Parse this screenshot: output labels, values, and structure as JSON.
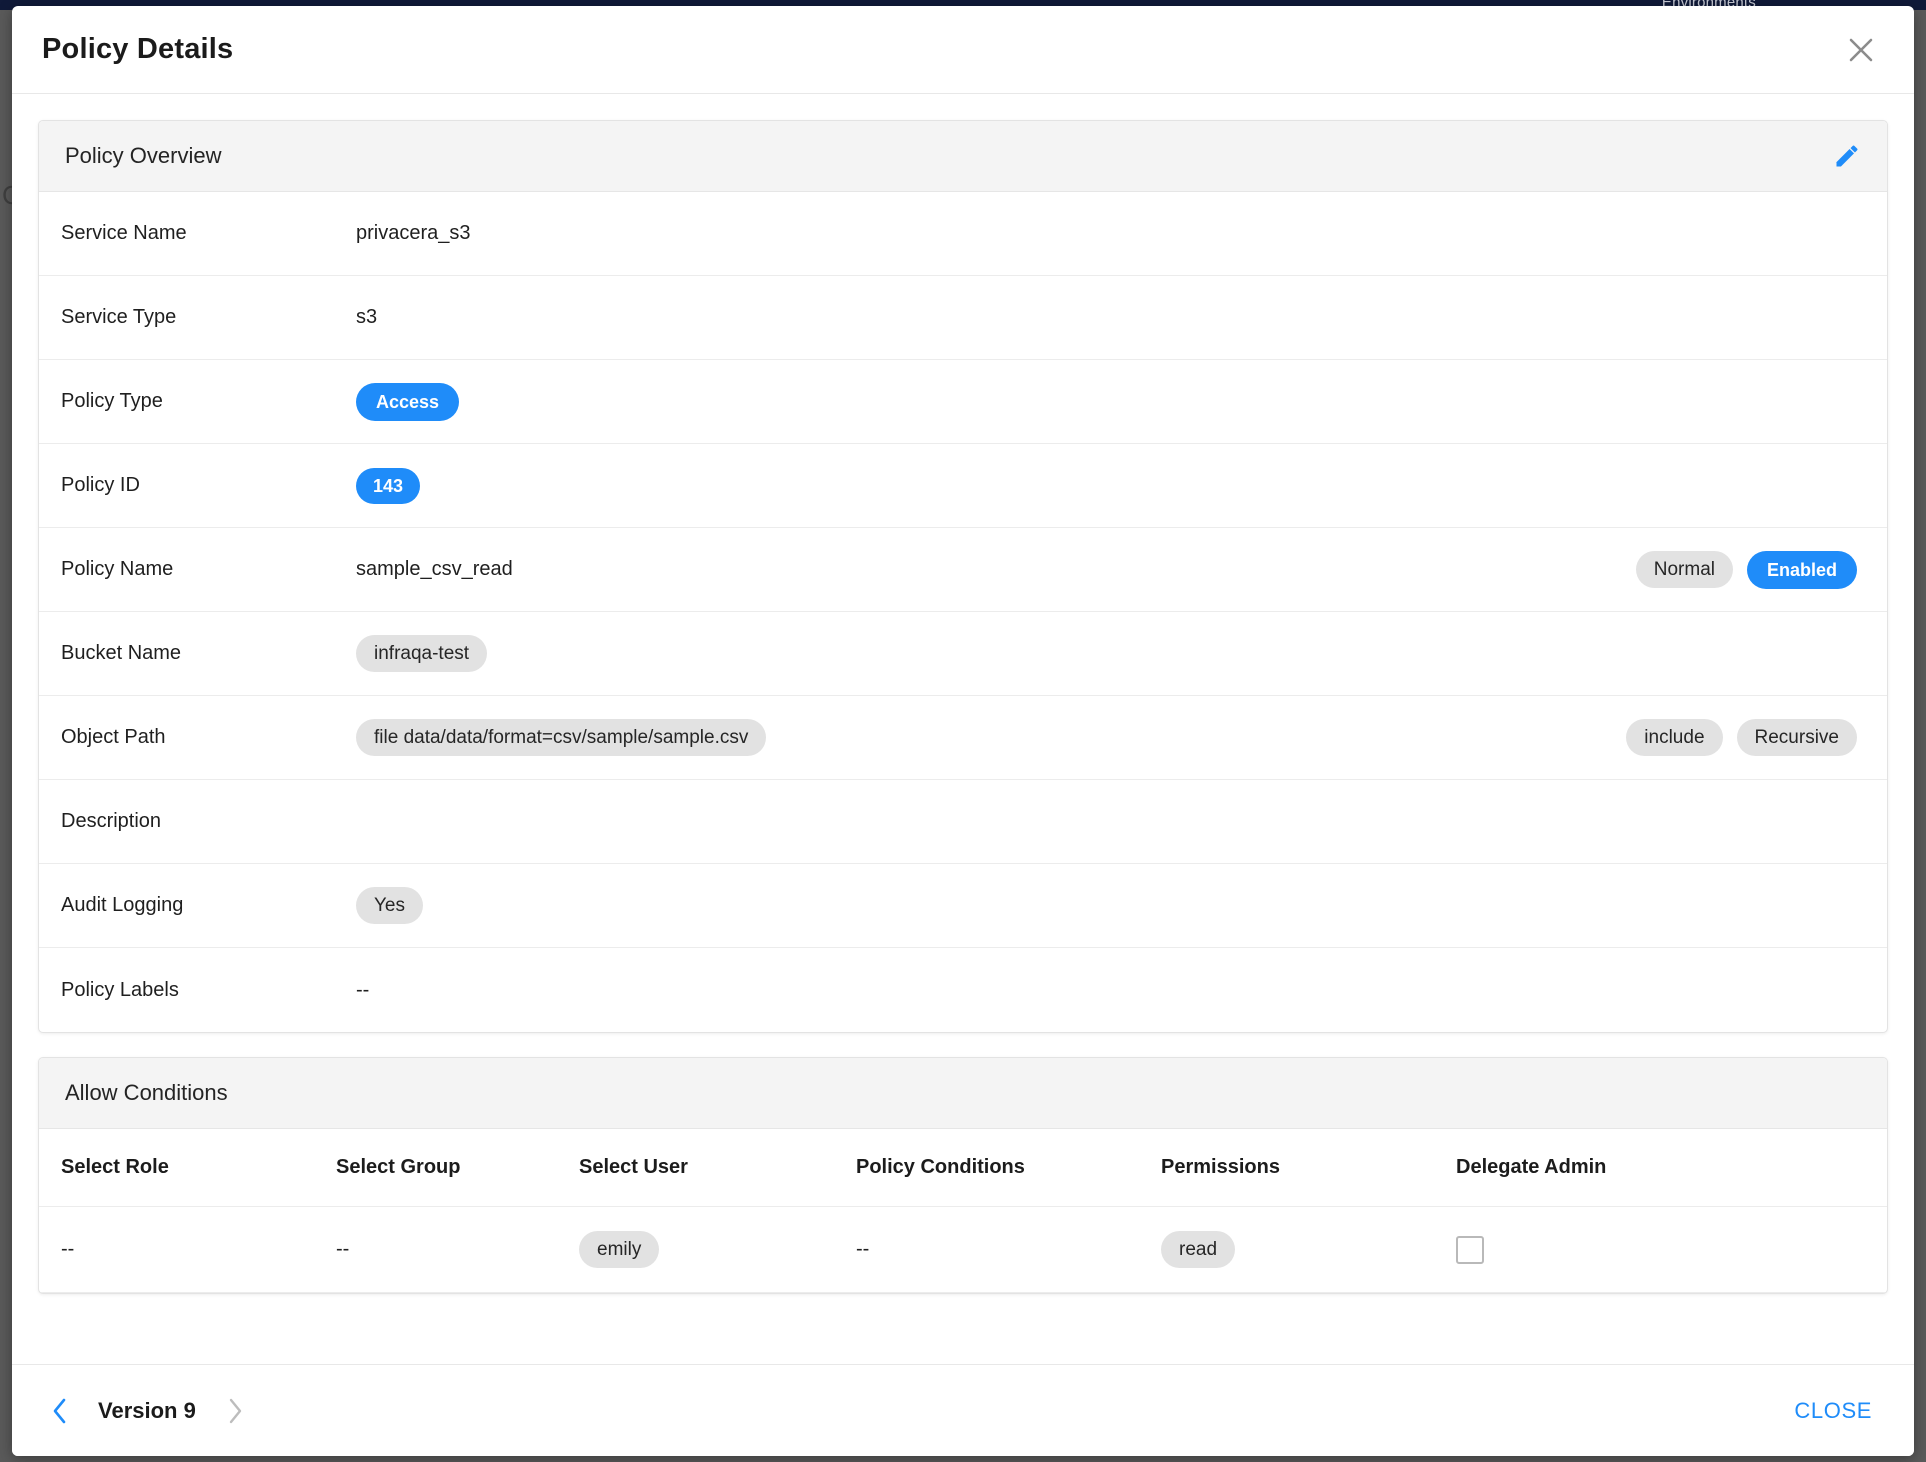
{
  "background": {
    "topbar_text": "Environments",
    "left_fragment": "C",
    "topbar_color": "#101a39"
  },
  "colors": {
    "accent_blue": "#1f8cf9",
    "chip_grey": "#e2e2e2",
    "card_header_grey": "#f4f4f4"
  },
  "header": {
    "title": "Policy Details",
    "close_icon": "close-icon"
  },
  "overview": {
    "section_title": "Policy Overview",
    "edit_icon": "pencil-icon",
    "rows": [
      {
        "label": "Service Name",
        "value": "privacera_s3",
        "kind": "text"
      },
      {
        "label": "Service Type",
        "value": "s3",
        "kind": "text"
      },
      {
        "label": "Policy Type",
        "value": "Access",
        "kind": "chip-blue"
      },
      {
        "label": "Policy ID",
        "value": "143",
        "kind": "chip-blue-sm"
      },
      {
        "label": "Policy Name",
        "value": "sample_csv_read",
        "kind": "text",
        "right": [
          {
            "text": "Normal",
            "style": "grey"
          },
          {
            "text": "Enabled",
            "style": "blue"
          }
        ]
      },
      {
        "label": "Bucket Name",
        "value": "infraqa-test",
        "kind": "chip"
      },
      {
        "label": "Object Path",
        "value": "file data/data/format=csv/sample/sample.csv",
        "kind": "chip",
        "right": [
          {
            "text": "include",
            "style": "grey"
          },
          {
            "text": "Recursive",
            "style": "grey"
          }
        ]
      },
      {
        "label": "Description",
        "value": "",
        "kind": "text"
      },
      {
        "label": "Audit Logging",
        "value": "Yes",
        "kind": "chip"
      },
      {
        "label": "Policy Labels",
        "value": "--",
        "kind": "text"
      }
    ]
  },
  "allow_conditions": {
    "section_title": "Allow Conditions",
    "columns": [
      "Select Role",
      "Select Group",
      "Select User",
      "Policy Conditions",
      "Permissions",
      "Delegate Admin"
    ],
    "rows": [
      {
        "select_role": "--",
        "select_group": "--",
        "select_user": "emily",
        "policy_conditions": "--",
        "permissions": "read",
        "delegate_admin": false
      }
    ]
  },
  "footer": {
    "prev_icon": "chevron-left-icon",
    "next_icon": "chevron-right-icon",
    "version_label": "Version 9",
    "close_label": "CLOSE"
  }
}
